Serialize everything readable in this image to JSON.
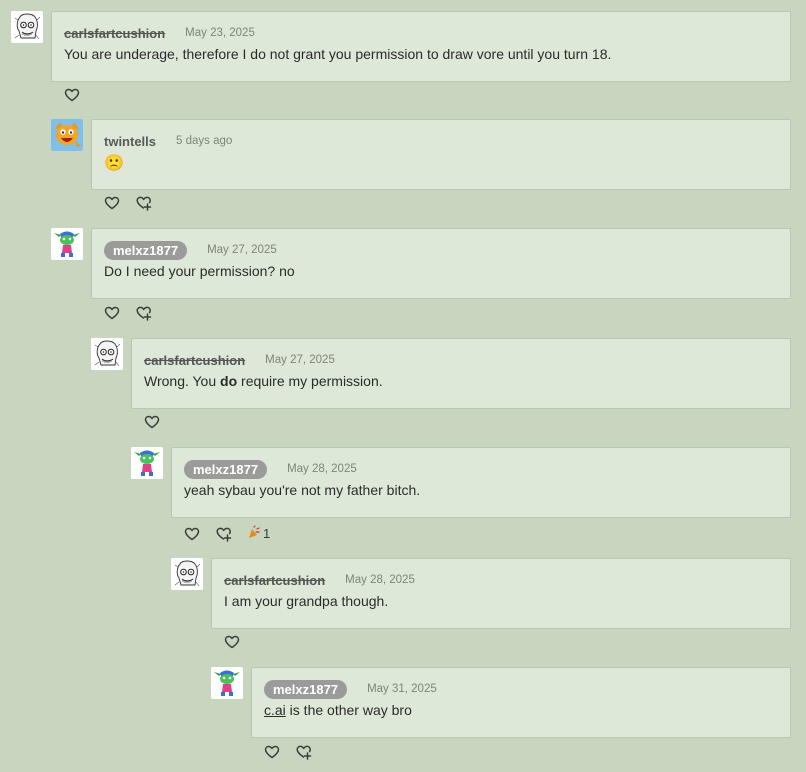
{
  "comments": [
    {
      "username": "carlsfartcushion",
      "date": "May 23, 2025",
      "text": "You are underage, therefore I do not grant you permission to draw vore until you turn 18."
    },
    {
      "username": "twintells",
      "date": "5 days ago",
      "text": "🙁"
    },
    {
      "username": "melxz1877",
      "date": "May 27, 2025",
      "text": "Do I need your permission? no"
    },
    {
      "username": "carlsfartcushion",
      "date": "May 27, 2025",
      "text_pre": "Wrong. You ",
      "text_bold": "do",
      "text_post": " require my permission."
    },
    {
      "username": "melxz1877",
      "date": "May 28, 2025",
      "text": "yeah sybau you're not my father bitch.",
      "reaction_count": "1"
    },
    {
      "username": "carlsfartcushion",
      "date": "May 28, 2025",
      "text": "I am your grandpa though."
    },
    {
      "username": "melxz1877",
      "date": "May 31, 2025",
      "text_link": "c.ai",
      "text_post": " is the other way bro"
    }
  ],
  "icons": {
    "like": "heart-outline-icon",
    "tip": "heart-tip-icon",
    "reaction": "party-popper-icon"
  },
  "colors": {
    "background": "#c8d6c0",
    "card": "#dee8d8",
    "pill": "#9b9b9b"
  }
}
